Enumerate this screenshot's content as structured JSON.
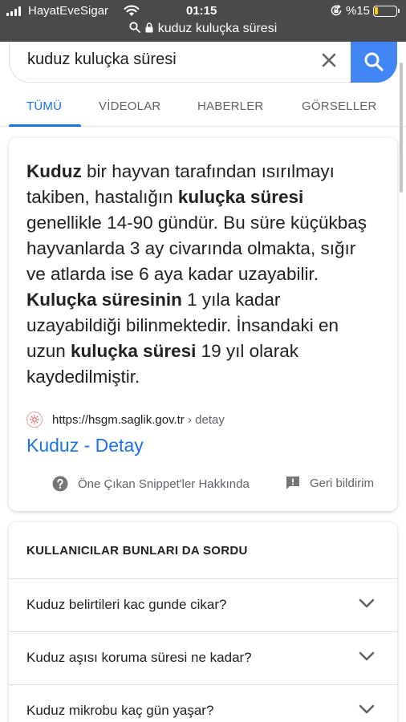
{
  "status_bar": {
    "carrier": "HayatEveSigar",
    "time": "01:15",
    "battery_percent_label": "%15",
    "battery_level": 0.15,
    "url": "kuduz kuluçka süresi"
  },
  "search": {
    "query": "kuduz kuluçka süresi"
  },
  "tabs": [
    {
      "label": "TÜMÜ",
      "active": true
    },
    {
      "label": "VİDEOLAR",
      "active": false
    },
    {
      "label": "HABERLER",
      "active": false
    },
    {
      "label": "GÖRSELLER",
      "active": false
    }
  ],
  "snippet": {
    "text_parts": [
      {
        "t": "Kuduz",
        "b": true
      },
      {
        "t": " bir hayvan tarafından ısırılmayı takiben, hastalığın ",
        "b": false
      },
      {
        "t": "kuluçka süresi",
        "b": true
      },
      {
        "t": " genellikle 14-90 gündür. Bu süre küçükbaş hayvanlarda 3 ay civarında olmakta, sığır ve atlarda ise 6 aya kadar uzayabilir. ",
        "b": false
      },
      {
        "t": "Kuluçka süresinin",
        "b": true
      },
      {
        "t": " 1 yıla kadar uzayabildiği bilinmektedir. İnsandaki en uzun ",
        "b": false
      },
      {
        "t": "kuluçka süresi",
        "b": true
      },
      {
        "t": " 19 yıl olarak kaydedilmiştir.",
        "b": false
      }
    ],
    "source_url": "https://hsgm.saglik.gov.tr",
    "source_path": "› detay",
    "title": "Kuduz - Detay",
    "about_label": "Öne Çıkan Snippet'ler Hakkında",
    "feedback_label": "Geri bildirim"
  },
  "paa": {
    "heading": "KULLANICILAR BUNLARI DA SORDU",
    "questions": [
      "Kuduz belirtileri kac gunde cikar?",
      "Kuduz aşısı koruma süresi ne kadar?",
      "Kuduz mikrobu kaç gün yaşar?"
    ]
  },
  "colors": {
    "accent": "#1a73e8",
    "search_button": "#4285f4",
    "status_bar": "#4a4a4c",
    "battery_fill": "#ffcc00"
  }
}
